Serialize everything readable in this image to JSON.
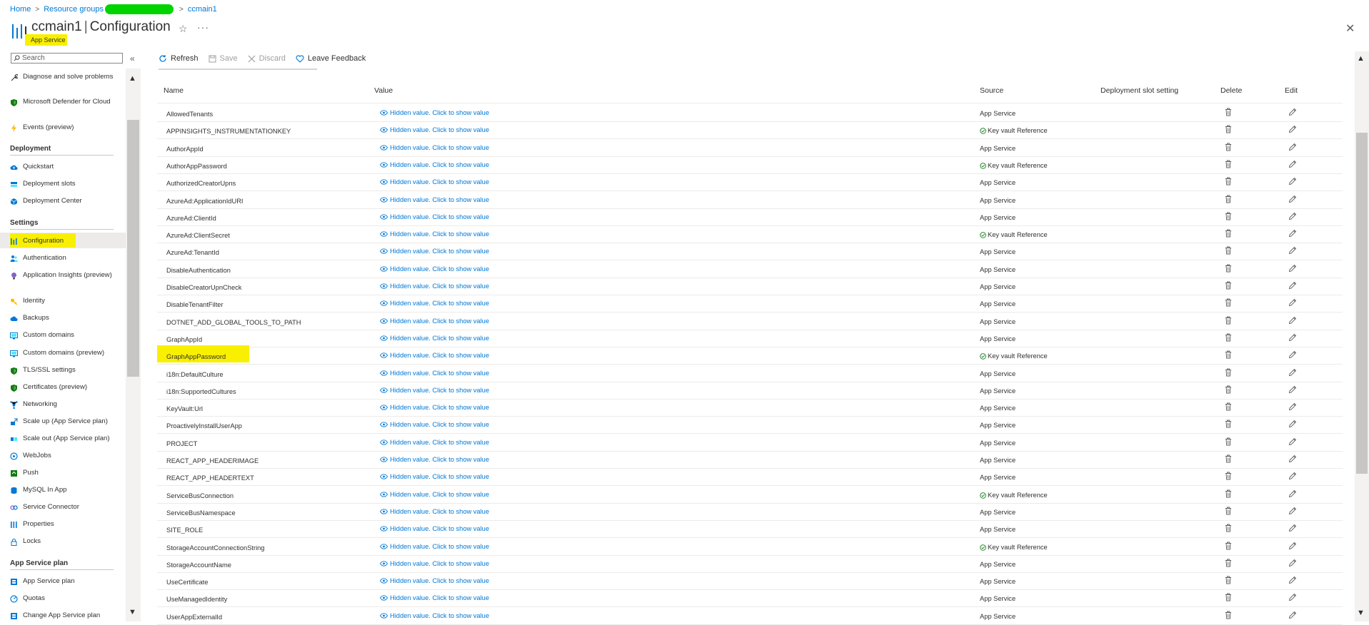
{
  "breadcrumb": {
    "home": "Home",
    "resource_groups": "Resource groups",
    "current": "ccmain1"
  },
  "header": {
    "resource_name": "ccmain1",
    "separator": "|",
    "page_title": "Configuration",
    "subtitle": "App Service",
    "star": "☆",
    "more": "···",
    "close": "✕"
  },
  "sidebar": {
    "search_placeholder": "Search",
    "collapse": "«",
    "top_items": [
      {
        "label": "Diagnose and solve problems",
        "icon": "wrench-icon"
      },
      {
        "label": "Microsoft Defender for Cloud",
        "icon": "shield-icon"
      },
      {
        "label": "Events (preview)",
        "icon": "lightning-icon"
      }
    ],
    "sections": [
      {
        "title": "Deployment",
        "items": [
          {
            "label": "Quickstart",
            "icon": "cloud-upload-icon"
          },
          {
            "label": "Deployment slots",
            "icon": "slots-icon"
          },
          {
            "label": "Deployment Center",
            "icon": "cube-icon"
          }
        ]
      },
      {
        "title": "Settings",
        "items": [
          {
            "label": "Configuration",
            "icon": "config-icon",
            "active": true
          },
          {
            "label": "Authentication",
            "icon": "people-icon"
          },
          {
            "label": "Application Insights (preview)",
            "icon": "lightbulb-icon"
          },
          {
            "label": "Identity",
            "icon": "key-icon"
          },
          {
            "label": "Backups",
            "icon": "cloud-icon"
          },
          {
            "label": "Custom domains",
            "icon": "globe-screen-icon"
          },
          {
            "label": "Custom domains (preview)",
            "icon": "globe-screen-icon"
          },
          {
            "label": "TLS/SSL settings",
            "icon": "shield-icon"
          },
          {
            "label": "Certificates (preview)",
            "icon": "shield-icon"
          },
          {
            "label": "Networking",
            "icon": "network-icon"
          },
          {
            "label": "Scale up (App Service plan)",
            "icon": "scale-up-icon"
          },
          {
            "label": "Scale out (App Service plan)",
            "icon": "scale-out-icon"
          },
          {
            "label": "WebJobs",
            "icon": "webjobs-icon"
          },
          {
            "label": "Push",
            "icon": "push-icon"
          },
          {
            "label": "MySQL In App",
            "icon": "database-icon"
          },
          {
            "label": "Service Connector",
            "icon": "connector-icon"
          },
          {
            "label": "Properties",
            "icon": "properties-icon"
          },
          {
            "label": "Locks",
            "icon": "lock-icon"
          }
        ]
      },
      {
        "title": "App Service plan",
        "items": [
          {
            "label": "App Service plan",
            "icon": "plan-icon"
          },
          {
            "label": "Quotas",
            "icon": "quota-icon"
          },
          {
            "label": "Change App Service plan",
            "icon": "plan-icon"
          }
        ]
      }
    ]
  },
  "toolbar": {
    "refresh": "Refresh",
    "save": "Save",
    "discard": "Discard",
    "feedback": "Leave Feedback"
  },
  "table": {
    "columns": {
      "name": "Name",
      "value": "Value",
      "source": "Source",
      "slot": "Deployment slot setting",
      "delete": "Delete",
      "edit": "Edit"
    },
    "rows": [
      {
        "name": "AllowedTenants",
        "value": "Hidden value. Click to show value",
        "source": "App Service",
        "keyvault": false
      },
      {
        "name": "APPINSIGHTS_INSTRUMENTATIONKEY",
        "value": "Hidden value. Click to show value",
        "source": "Key vault Reference",
        "keyvault": true
      },
      {
        "name": "AuthorAppId",
        "value": "Hidden value. Click to show value",
        "source": "App Service",
        "keyvault": false
      },
      {
        "name": "AuthorAppPassword",
        "value": "Hidden value. Click to show value",
        "source": "Key vault Reference",
        "keyvault": true
      },
      {
        "name": "AuthorizedCreatorUpns",
        "value": "Hidden value. Click to show value",
        "source": "App Service",
        "keyvault": false
      },
      {
        "name": "AzureAd:ApplicationIdURI",
        "value": "Hidden value. Click to show value",
        "source": "App Service",
        "keyvault": false
      },
      {
        "name": "AzureAd:ClientId",
        "value": "Hidden value. Click to show value",
        "source": "App Service",
        "keyvault": false
      },
      {
        "name": "AzureAd:ClientSecret",
        "value": "Hidden value. Click to show value",
        "source": "Key vault Reference",
        "keyvault": true
      },
      {
        "name": "AzureAd:TenantId",
        "value": "Hidden value. Click to show value",
        "source": "App Service",
        "keyvault": false
      },
      {
        "name": "DisableAuthentication",
        "value": "Hidden value. Click to show value",
        "source": "App Service",
        "keyvault": false
      },
      {
        "name": "DisableCreatorUpnCheck",
        "value": "Hidden value. Click to show value",
        "source": "App Service",
        "keyvault": false
      },
      {
        "name": "DisableTenantFilter",
        "value": "Hidden value. Click to show value",
        "source": "App Service",
        "keyvault": false
      },
      {
        "name": "DOTNET_ADD_GLOBAL_TOOLS_TO_PATH",
        "value": "Hidden value. Click to show value",
        "source": "App Service",
        "keyvault": false
      },
      {
        "name": "GraphAppId",
        "value": "Hidden value. Click to show value",
        "source": "App Service",
        "keyvault": false
      },
      {
        "name": "GraphAppPassword",
        "value": "Hidden value. Click to show value",
        "source": "Key vault Reference",
        "keyvault": true,
        "highlight": true
      },
      {
        "name": "i18n:DefaultCulture",
        "value": "Hidden value. Click to show value",
        "source": "App Service",
        "keyvault": false
      },
      {
        "name": "i18n:SupportedCultures",
        "value": "Hidden value. Click to show value",
        "source": "App Service",
        "keyvault": false
      },
      {
        "name": "KeyVault:Url",
        "value": "Hidden value. Click to show value",
        "source": "App Service",
        "keyvault": false
      },
      {
        "name": "ProactivelyInstallUserApp",
        "value": "Hidden value. Click to show value",
        "source": "App Service",
        "keyvault": false
      },
      {
        "name": "PROJECT",
        "value": "Hidden value. Click to show value",
        "source": "App Service",
        "keyvault": false
      },
      {
        "name": "REACT_APP_HEADERIMAGE",
        "value": "Hidden value. Click to show value",
        "source": "App Service",
        "keyvault": false
      },
      {
        "name": "REACT_APP_HEADERTEXT",
        "value": "Hidden value. Click to show value",
        "source": "App Service",
        "keyvault": false
      },
      {
        "name": "ServiceBusConnection",
        "value": "Hidden value. Click to show value",
        "source": "Key vault Reference",
        "keyvault": true
      },
      {
        "name": "ServiceBusNamespace",
        "value": "Hidden value. Click to show value",
        "source": "App Service",
        "keyvault": false
      },
      {
        "name": "SITE_ROLE",
        "value": "Hidden value. Click to show value",
        "source": "App Service",
        "keyvault": false
      },
      {
        "name": "StorageAccountConnectionString",
        "value": "Hidden value. Click to show value",
        "source": "Key vault Reference",
        "keyvault": true
      },
      {
        "name": "StorageAccountName",
        "value": "Hidden value. Click to show value",
        "source": "App Service",
        "keyvault": false
      },
      {
        "name": "UseCertificate",
        "value": "Hidden value. Click to show value",
        "source": "App Service",
        "keyvault": false
      },
      {
        "name": "UseManagedIdentity",
        "value": "Hidden value. Click to show value",
        "source": "App Service",
        "keyvault": false
      },
      {
        "name": "UserAppExternalId",
        "value": "Hidden value. Click to show value",
        "source": "App Service",
        "keyvault": false
      }
    ]
  },
  "colors": {
    "accent": "#0078d4",
    "highlight": "#f8f000",
    "keyvault_check": "#107c10",
    "redaction": "#00d400"
  }
}
